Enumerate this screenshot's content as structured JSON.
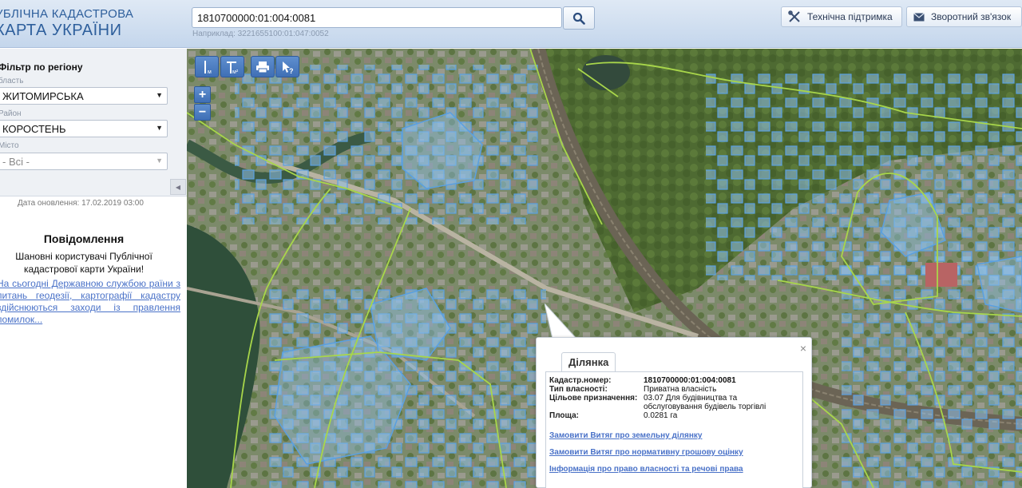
{
  "header": {
    "logo_line1": "УБЛІЧНА КАДАСТРОВА",
    "logo_line2": "КАРТА УКРАЇНИ",
    "search_value": "1810700000:01:004:0081",
    "search_hint": "Наприклад: 3221655100:01:047:0052",
    "support_label": "Технічна підтримка",
    "feedback_label": "Зворотний зв'язок"
  },
  "sidebar": {
    "filter_title": "Фільтр по регіону",
    "oblast_label": "бласть",
    "oblast_value": "ЖИТОМИРСЬКА",
    "rayon_label": "Район",
    "rayon_value": "КОРОСТЕНЬ",
    "misto_label": "Місто",
    "misto_value": "- Всі -",
    "update_date": "Дата оновлення: 17.02.2019 03:00",
    "notice_title": "Повідомлення",
    "notice_sub": "Шановні користувачі Публічної кадастрової карти України!",
    "notice_link": "На сьогодні Державною службою раїни з питань геодезії, картографії кадастру здійснюються заходи із правлення помилок..."
  },
  "map_tools": {
    "measure_line": "м",
    "measure_area": "м²",
    "zoom_in": "+",
    "zoom_out": "−"
  },
  "popup": {
    "tab_label": "Ділянка",
    "close": "×",
    "rows": [
      {
        "key": "Кадастр.номер:",
        "value": "1810700000:01:004:0081"
      },
      {
        "key": "Тип власності:",
        "value": "Приватна власність"
      },
      {
        "key": "Цільове призначення:",
        "value": "03.07 Для будівництва та обслуговування будівель торгівлі"
      },
      {
        "key": "Площа:",
        "value": "0.0281 га"
      }
    ],
    "link1": "Замовити Витяг про земельну ділянку",
    "link2": "Замовити Витяг про нормативну грошову оцінку",
    "link3": "Інформація про право власності та речові права"
  },
  "colors": {
    "parcel_fill": "#8fbfe8",
    "parcel_stroke": "#5aa0e0",
    "boundary": "#a8d64a",
    "link": "#4a72c8"
  }
}
